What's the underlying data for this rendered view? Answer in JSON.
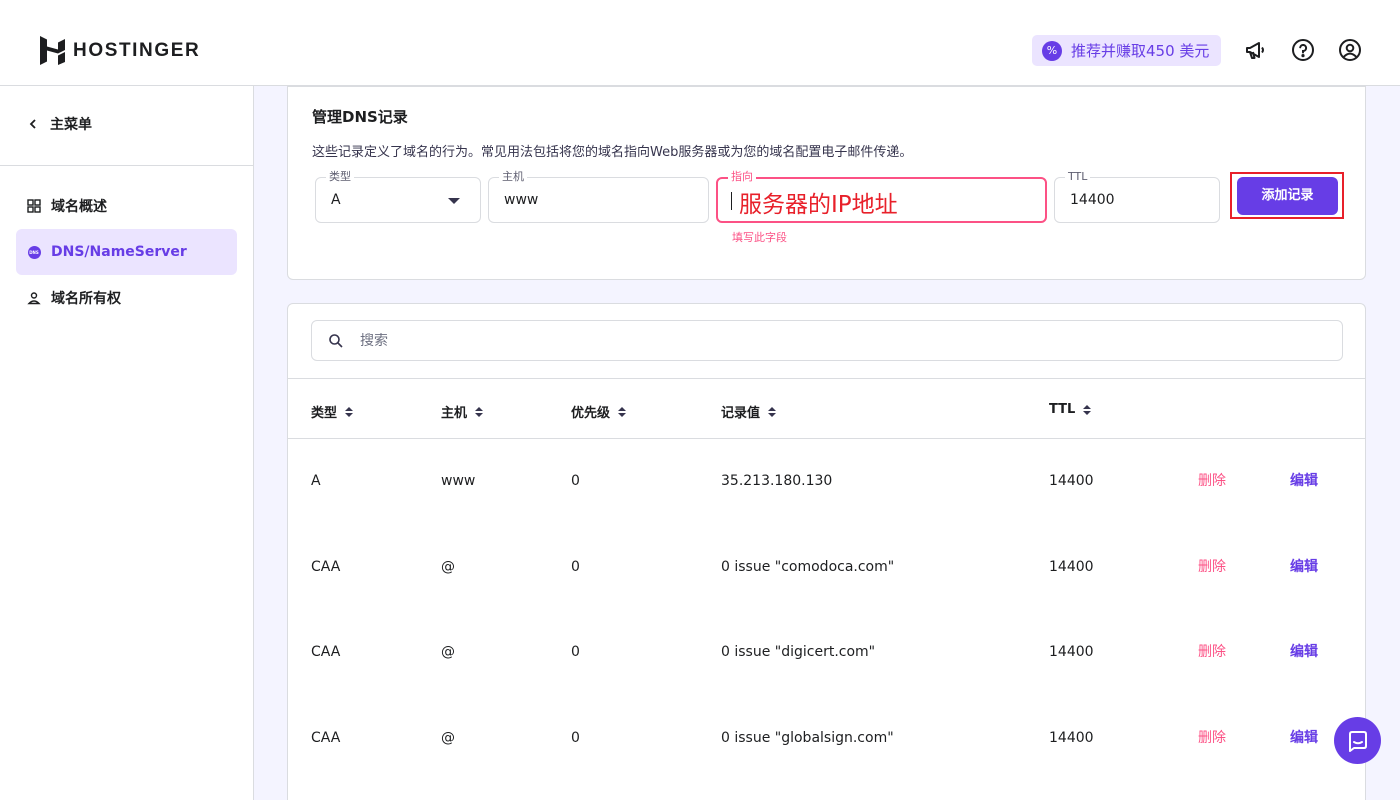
{
  "header": {
    "brand": "HOSTINGER",
    "referral_label": "推荐并赚取450 美元"
  },
  "sidebar": {
    "back_label": "主菜单",
    "items": [
      {
        "label": "域名概述",
        "icon": "grid-icon"
      },
      {
        "label": "DNS/NameServer",
        "icon": "dns-icon",
        "active": true
      },
      {
        "label": "域名所有权",
        "icon": "user-icon"
      }
    ]
  },
  "dns_form": {
    "title": "管理DNS记录",
    "description": "这些记录定义了域名的行为。常见用法包括将您的域名指向Web服务器或为您的域名配置电子邮件传递。",
    "type": {
      "label": "类型",
      "value": "A"
    },
    "host": {
      "label": "主机",
      "value": "www"
    },
    "points_to": {
      "label": "指向",
      "annotation": "服务器的IP地址",
      "error": "填写此字段"
    },
    "ttl": {
      "label": "TTL",
      "value": "14400"
    },
    "add_button": "添加记录"
  },
  "records": {
    "search_placeholder": "搜索",
    "columns": [
      "类型",
      "主机",
      "优先级",
      "记录值",
      "TTL"
    ],
    "delete_label": "删除",
    "edit_label": "编辑",
    "rows": [
      {
        "type": "A",
        "host": "www",
        "priority": "0",
        "value": "35.213.180.130",
        "ttl": "14400"
      },
      {
        "type": "CAA",
        "host": "@",
        "priority": "0",
        "value": "0 issue \"comodoca.com\"",
        "ttl": "14400"
      },
      {
        "type": "CAA",
        "host": "@",
        "priority": "0",
        "value": "0 issue \"digicert.com\"",
        "ttl": "14400"
      },
      {
        "type": "CAA",
        "host": "@",
        "priority": "0",
        "value": "0 issue \"globalsign.com\"",
        "ttl": "14400"
      }
    ]
  },
  "colors": {
    "accent": "#673de6",
    "danger": "#fc5185",
    "annotation": "#e8202a"
  }
}
